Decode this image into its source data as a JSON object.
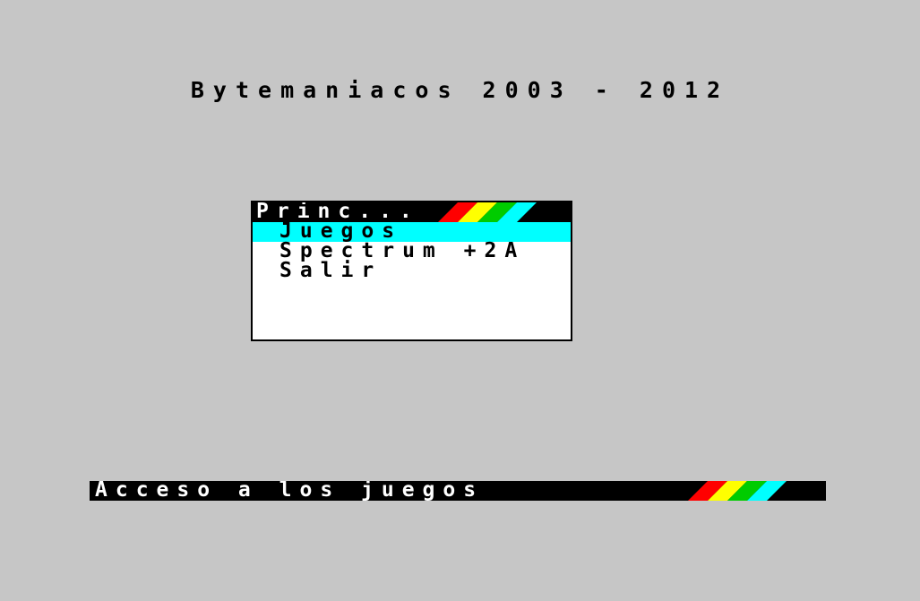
{
  "banner": {
    "text": "Bytemaniacos 2003 - 2012"
  },
  "menu": {
    "title": "Princ...",
    "items": [
      {
        "label": "Juegos",
        "selected": true
      },
      {
        "label": "Spectrum +2A",
        "selected": false
      },
      {
        "label": "Salir",
        "selected": false
      }
    ]
  },
  "status": {
    "text": "Acceso a los juegos"
  },
  "colors": {
    "background": "#c6c6c6",
    "highlight": "#00ffff",
    "stripe_red": "#ff0000",
    "stripe_yellow": "#ffff00",
    "stripe_green": "#00cc00",
    "stripe_cyan": "#00ffff"
  },
  "icons": {
    "title_stripes": "spectrum-rainbow-stripes-icon",
    "status_stripes": "spectrum-rainbow-stripes-icon"
  }
}
